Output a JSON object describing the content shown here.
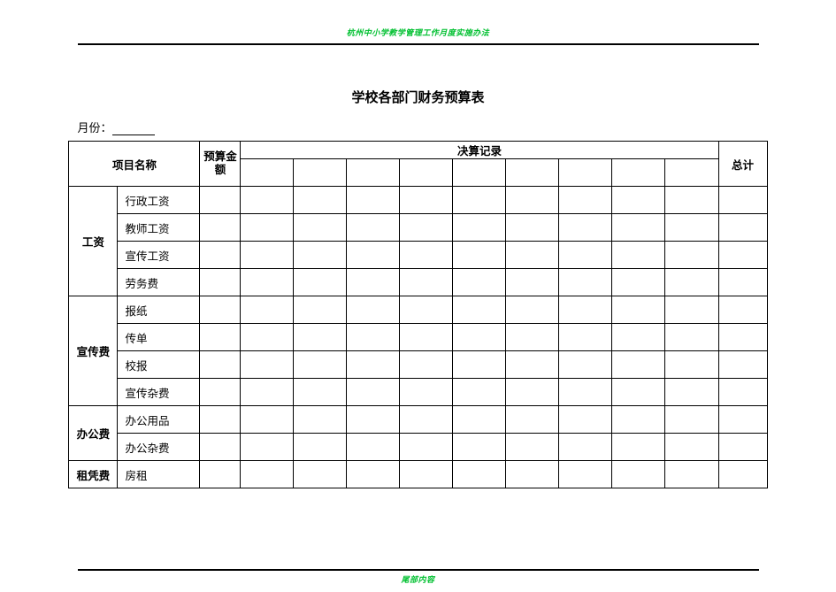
{
  "header_note": "杭州中小学教学管理工作月度实施办法",
  "footer_note": "尾部内容",
  "title": "学校各部门财务预算表",
  "month_label_prefix": "月份：",
  "headers": {
    "item_name": "项目名称",
    "budget_amount": "预算金\n额",
    "settlement_record": "决算记录",
    "total": "总计"
  },
  "num_record_cols": 9,
  "categories": [
    {
      "name": "工资",
      "sub_items": [
        "行政工资",
        "教师工资",
        "宣传工资",
        "劳务费"
      ]
    },
    {
      "name": "宣传费",
      "sub_items": [
        "报纸",
        "传单",
        "校报",
        "宣传杂费"
      ]
    },
    {
      "name": "办公费",
      "sub_items": [
        "办公用品",
        "办公杂费"
      ]
    },
    {
      "name": "租凭费",
      "sub_items": [
        "房租"
      ]
    }
  ]
}
